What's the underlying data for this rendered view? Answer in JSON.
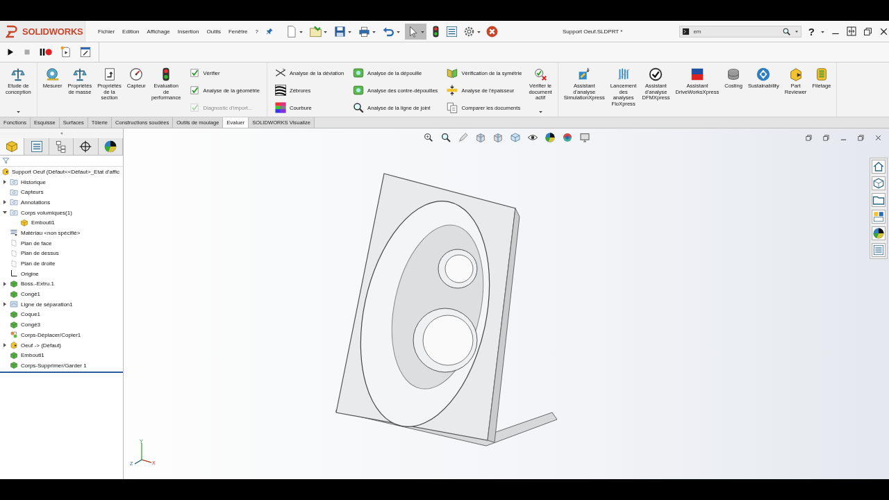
{
  "app": {
    "logo": "SOLIDWORKS",
    "menu": [
      "Fichier",
      "Edition",
      "Affichage",
      "Insertion",
      "Outils",
      "Fenêtre",
      "?"
    ],
    "document_title": "Support Oeuf.SLDPRT *",
    "search": {
      "value": "em"
    },
    "help": "?"
  },
  "ribbon": {
    "groups": [
      {
        "columns": [
          {
            "kind": "large",
            "label": "Etude de\nconception",
            "dropdown": true
          }
        ]
      },
      {
        "columns": [
          {
            "kind": "large",
            "label": "Mesurer",
            "dropdown": false
          },
          {
            "kind": "large",
            "label": "Propriétés\nde masse",
            "dropdown": false
          },
          {
            "kind": "large",
            "label": "Propriétés\nde la\nsection",
            "dropdown": false
          },
          {
            "kind": "large",
            "label": "Capteur",
            "dropdown": false
          },
          {
            "kind": "large",
            "label": "Evaluation\nde\nperformance",
            "dropdown": false
          },
          {
            "kind": "stack",
            "items": [
              {
                "label": "Vérifier",
                "disabled": false
              },
              {
                "label": "Analyse de la géométrie",
                "disabled": false
              },
              {
                "label": "Diagnostic d'import...",
                "disabled": true
              }
            ]
          }
        ]
      },
      {
        "columns": [
          {
            "kind": "stack",
            "items": [
              {
                "label": "Analyse de la déviation",
                "disabled": false
              },
              {
                "label": "Zébrures",
                "disabled": false
              },
              {
                "label": "Courbure",
                "disabled": false
              }
            ]
          },
          {
            "kind": "stack",
            "items": [
              {
                "label": "Analyse de la dépouille",
                "disabled": false
              },
              {
                "label": "Analyse des contre-dépouilles",
                "disabled": false
              },
              {
                "label": "Analyse de la ligne de joint",
                "disabled": false
              }
            ]
          },
          {
            "kind": "stack",
            "items": [
              {
                "label": "Vérification de la symétrie",
                "disabled": false
              },
              {
                "label": "Analyse de l'épaisseur",
                "disabled": false
              },
              {
                "label": "Comparer les documents",
                "disabled": false
              }
            ]
          },
          {
            "kind": "large",
            "label": "Vérifier le\ndocument\nactif",
            "dropdown": true
          }
        ]
      },
      {
        "columns": [
          {
            "kind": "large",
            "label": "Assistant\nd'analyse\nSimulationXpress",
            "dropdown": false
          },
          {
            "kind": "large",
            "label": "Lancement\ndes\nanalyses\nFloXpress",
            "dropdown": false
          },
          {
            "kind": "large",
            "label": "Assistant\nd'analyse\nDFMXpress",
            "dropdown": false
          },
          {
            "kind": "large",
            "label": "Assistant\nDriveWorksXpress",
            "dropdown": false
          },
          {
            "kind": "large",
            "label": "Costing",
            "dropdown": false
          },
          {
            "kind": "large",
            "label": "Sustainability",
            "dropdown": false
          },
          {
            "kind": "large",
            "label": "Part\nReviewer",
            "dropdown": false
          },
          {
            "kind": "large",
            "label": "Filetage",
            "dropdown": false
          }
        ]
      }
    ]
  },
  "tabs": [
    {
      "label": "Fonctions",
      "selected": false
    },
    {
      "label": "Esquisse",
      "selected": false
    },
    {
      "label": "Surfaces",
      "selected": false
    },
    {
      "label": "Tôlerie",
      "selected": false
    },
    {
      "label": "Constructions soudées",
      "selected": false
    },
    {
      "label": "Outils de moulage",
      "selected": false
    },
    {
      "label": "Evaluer",
      "selected": true
    },
    {
      "label": "SOLIDWORKS Visualize",
      "selected": false
    }
  ],
  "panel_tabs": [
    {
      "selected": true
    },
    {
      "selected": false
    },
    {
      "selected": false
    },
    {
      "selected": false
    },
    {
      "selected": false
    }
  ],
  "tree": {
    "root": "Support Oeuf  (Défaut<<Défaut>_Etat d'affic",
    "items": [
      {
        "label": "Historique",
        "kind": "folder",
        "expandable": true,
        "expanded": false
      },
      {
        "label": "Capteurs",
        "kind": "folder",
        "expandable": false,
        "expanded": false
      },
      {
        "label": "Annotations",
        "kind": "folder",
        "expandable": true,
        "expanded": false
      },
      {
        "label": "Corps volumiques(1)",
        "kind": "folder",
        "expandable": true,
        "expanded": true,
        "children": [
          {
            "label": "Embouti1",
            "kind": "body",
            "expandable": false,
            "expanded": false
          }
        ]
      },
      {
        "label": "Matériau <non spécifié>",
        "kind": "material",
        "expandable": false,
        "expanded": false
      },
      {
        "label": "Plan de face",
        "kind": "plane",
        "expandable": false,
        "expanded": false
      },
      {
        "label": "Plan de dessus",
        "kind": "plane",
        "expandable": false,
        "expanded": false
      },
      {
        "label": "Plan de droite",
        "kind": "plane",
        "expandable": false,
        "expanded": false
      },
      {
        "label": "Origine",
        "kind": "origin",
        "expandable": false,
        "expanded": false
      },
      {
        "label": "Boss.-Extru.1",
        "kind": "feature",
        "expandable": true,
        "expanded": false
      },
      {
        "label": "Congé1",
        "kind": "feature",
        "expandable": false,
        "expanded": false
      },
      {
        "label": "Ligne de séparation1",
        "kind": "split",
        "expandable": true,
        "expanded": false
      },
      {
        "label": "Coque1",
        "kind": "feature",
        "expandable": false,
        "expanded": false
      },
      {
        "label": "Congé3",
        "kind": "feature",
        "expandable": false,
        "expanded": false
      },
      {
        "label": "Corps-Déplacer/Copier1",
        "kind": "move",
        "expandable": false,
        "expanded": false
      },
      {
        "label": "Oeuf -> (Défaut)",
        "kind": "part",
        "expandable": true,
        "expanded": false
      },
      {
        "label": "Embouti1",
        "kind": "feature",
        "expandable": false,
        "expanded": false
      },
      {
        "label": "Corps-Supprimer/Garder 1",
        "kind": "feature",
        "expandable": false,
        "expanded": false
      }
    ]
  },
  "triad": {
    "labels": [
      "Y",
      "Z",
      "X"
    ]
  }
}
